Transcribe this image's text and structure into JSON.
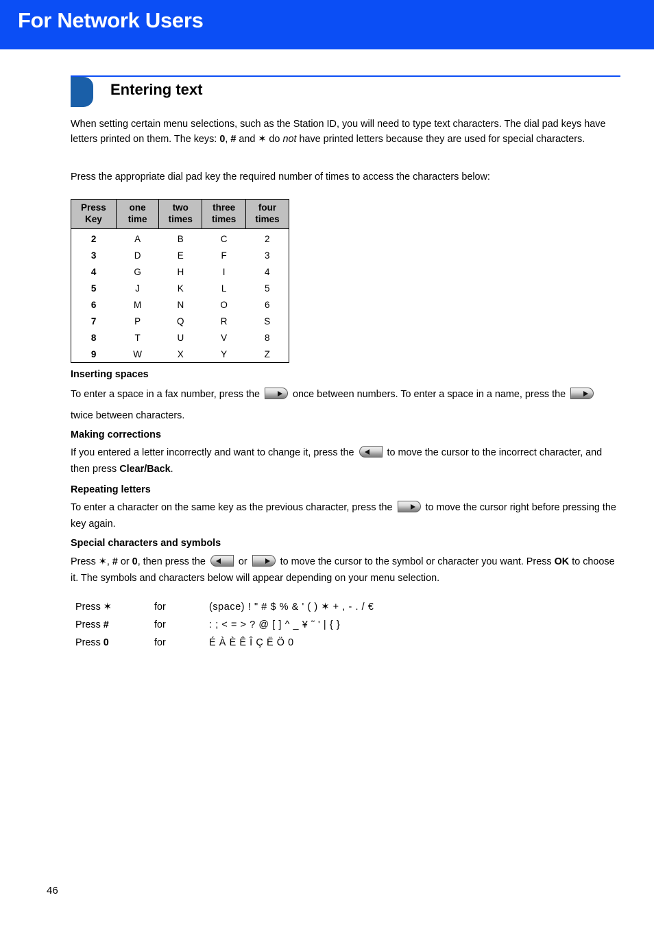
{
  "banner": {
    "title": "For Network Users",
    "background_color": "#0B4EF5"
  },
  "section": {
    "title": "Entering text",
    "marker_color": "#1A5FA8",
    "rule_color": "#0B4EF5"
  },
  "intro": {
    "line_a": "When setting certain menu selections, such as the Station ID, you will need to type text characters. The dial pad keys have letters printed on them. The keys: ",
    "key_zero": "0",
    "comma": ", ",
    "key_hash": "#",
    "and_text": " and ",
    "key_star": "✶",
    "do_text": " do ",
    "not_text": "not",
    "line_b": " have printed letters because they are used for special characters.",
    "press_line": "Press the appropriate dial pad key the required number of times to access the characters below:"
  },
  "key_table": {
    "headers": [
      "Press Key",
      "one time",
      "two times",
      "three times",
      "four times"
    ],
    "header_lines": [
      [
        "Press",
        "Key"
      ],
      [
        "one",
        "time"
      ],
      [
        "two",
        "times"
      ],
      [
        "three",
        "times"
      ],
      [
        "four",
        "times"
      ]
    ],
    "rows": [
      [
        "2",
        "A",
        "B",
        "C",
        "2"
      ],
      [
        "3",
        "D",
        "E",
        "F",
        "3"
      ],
      [
        "4",
        "G",
        "H",
        "I",
        "4"
      ],
      [
        "5",
        "J",
        "K",
        "L",
        "5"
      ],
      [
        "6",
        "M",
        "N",
        "O",
        "6"
      ],
      [
        "7",
        "P",
        "Q",
        "R",
        "S"
      ],
      [
        "8",
        "T",
        "U",
        "V",
        "8"
      ],
      [
        "9",
        "W",
        "X",
        "Y",
        "Z"
      ]
    ],
    "header_background": "#C0C0C0"
  },
  "inserting_spaces": {
    "heading": "Inserting spaces",
    "text_1": "To enter a space in a fax number, press the ",
    "text_2": " once between numbers. To enter a space in a name, press the ",
    "text_3": " twice between characters."
  },
  "making_corrections": {
    "heading": "Making corrections",
    "text_1": "If you entered a letter incorrectly and want to change it, press the ",
    "text_2": " to move the cursor to the incorrect character, and then press ",
    "bold_1": "Clear/Back",
    "text_3": "."
  },
  "repeating_letters": {
    "heading": "Repeating letters",
    "text_1": "To enter a character on the same key as the previous character, press  the ",
    "text_2": " to move the cursor right before pressing the key again."
  },
  "special_characters": {
    "heading": "Special characters and symbols",
    "text_1": "Press ",
    "star": "✶",
    "text_2": ", ",
    "hash": "#",
    "text_3": " or ",
    "zero": "0",
    "text_4": ", then press the ",
    "text_5": " or ",
    "text_6": " to move the cursor to the symbol or character you want. Press ",
    "bold_ok": "OK",
    "text_7": " to choose it. The symbols and characters below will appear depending on your menu selection."
  },
  "special_rows": [
    {
      "press_label": "Press ",
      "press_key": "✶",
      "for_label": "for",
      "characters": "(space) ! \" # $ % & ' ( ) ✶ + , - . / €"
    },
    {
      "press_label": "Press ",
      "press_key": "#",
      "for_label": "for",
      "characters": ": ; < = > ? @ [ ] ^ _ ¥ ˜ ' | { }"
    },
    {
      "press_label": "Press ",
      "press_key": "0",
      "for_label": "for",
      "characters": "É À È Ê Î Ç Ë Ö 0"
    }
  ],
  "footer": {
    "page_number": "46"
  }
}
